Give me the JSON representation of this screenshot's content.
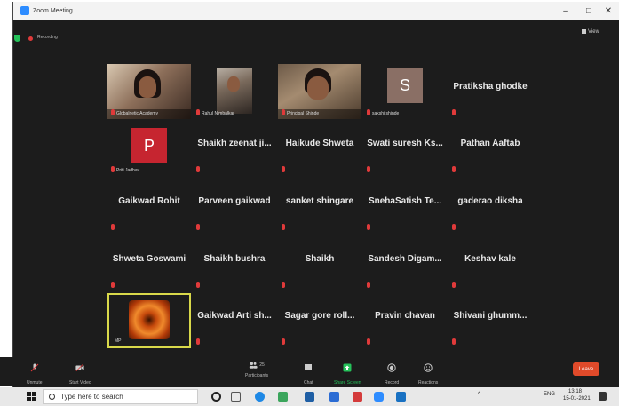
{
  "window": {
    "title": "Zoom Meeting",
    "controls": [
      "–",
      "□",
      "✕"
    ]
  },
  "topbar": {
    "recording": "Recording",
    "view": "View"
  },
  "participants": [
    {
      "name": "Globalnetic Academy",
      "type": "video",
      "caption": "Globalnetic Academy"
    },
    {
      "name": "Rahul Nimbalkar",
      "type": "video",
      "caption": "Rahul Nimbalkar"
    },
    {
      "name": "Principal Shinde",
      "type": "video",
      "caption": "Principal Shinde"
    },
    {
      "name": "Sakshi Shinde",
      "type": "avatar",
      "initial": "S",
      "color": "#8a6f65",
      "caption": "sakshi shinde"
    },
    {
      "name": "Pratiksha ghodke",
      "type": "name"
    },
    {
      "name": "Priti Jadhav",
      "type": "avatar",
      "initial": "P",
      "color": "#c62530",
      "caption": "Priti Jadhav"
    },
    {
      "name": "Shaikh zeenat ji...",
      "type": "name"
    },
    {
      "name": "Haikude Shweta",
      "type": "name"
    },
    {
      "name": "Swati suresh Ks...",
      "type": "name"
    },
    {
      "name": "Pathan Aaftab",
      "type": "name"
    },
    {
      "name": "Gaikwad Rohit",
      "type": "name"
    },
    {
      "name": "Parveen gaikwad",
      "type": "name"
    },
    {
      "name": "sanket shingare",
      "type": "name"
    },
    {
      "name": "SnehaSatish Te...",
      "type": "name"
    },
    {
      "name": "gaderao diksha",
      "type": "name"
    },
    {
      "name": "Shweta Goswami",
      "type": "name"
    },
    {
      "name": "Shaikh bushra",
      "type": "name"
    },
    {
      "name": "Shaikh",
      "type": "name"
    },
    {
      "name": "Sandesh Digam...",
      "type": "name"
    },
    {
      "name": "Keshav kale",
      "type": "name"
    },
    {
      "name": "MP",
      "type": "flower",
      "caption": "MP"
    },
    {
      "name": "Gaikwad Arti sh...",
      "type": "name"
    },
    {
      "name": "Sagar gore roll...",
      "type": "name"
    },
    {
      "name": "Pravin chavan",
      "type": "name"
    },
    {
      "name": "Shivani ghumm...",
      "type": "name"
    }
  ],
  "controls": {
    "unmute": "Unmute",
    "start_video": "Start Video",
    "participants": "Participants",
    "participants_count": "25",
    "chat": "Chat",
    "share_screen": "Share Screen",
    "record": "Record",
    "reactions": "Reactions",
    "leave": "Leave"
  },
  "taskbar": {
    "search_placeholder": "Type here to search",
    "language": "ENG",
    "time": "13:18",
    "date": "15-01-2021"
  },
  "colors": {
    "zoom_blue": "#2d8cff",
    "meeting_bg": "#1c1c1c",
    "leave_red": "#e04a2a",
    "share_green": "#25c25a",
    "muted_red": "#e03a3a"
  }
}
